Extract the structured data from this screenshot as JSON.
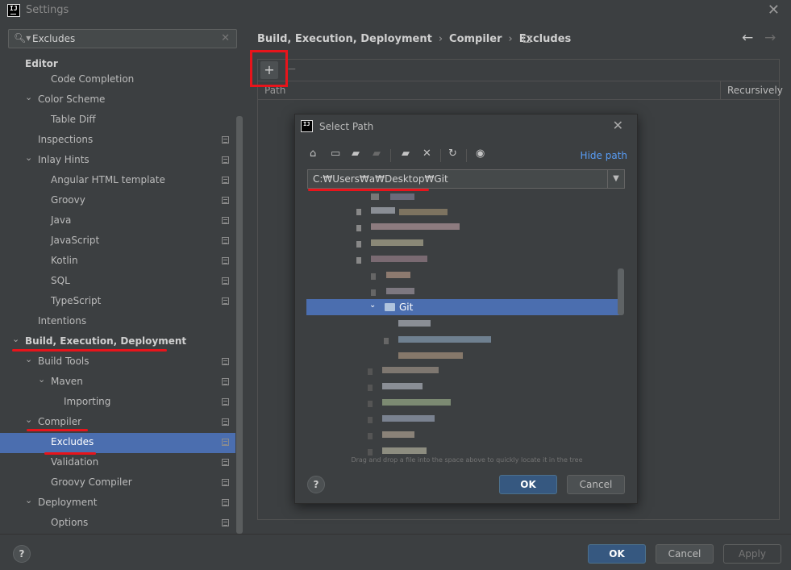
{
  "window": {
    "title": "Settings",
    "logo_text": "IJ"
  },
  "search": {
    "value": "Excludes"
  },
  "sidebar": {
    "items": [
      {
        "label": "Editor"
      },
      {
        "label": "Code Completion"
      },
      {
        "label": "Color Scheme"
      },
      {
        "label": "Table Diff"
      },
      {
        "label": "Inspections"
      },
      {
        "label": "Inlay Hints"
      },
      {
        "label": "Angular HTML template"
      },
      {
        "label": "Groovy"
      },
      {
        "label": "Java"
      },
      {
        "label": "JavaScript"
      },
      {
        "label": "Kotlin"
      },
      {
        "label": "SQL"
      },
      {
        "label": "TypeScript"
      },
      {
        "label": "Intentions"
      },
      {
        "label": "Build, Execution, Deployment"
      },
      {
        "label": "Build Tools"
      },
      {
        "label": "Maven"
      },
      {
        "label": "Importing"
      },
      {
        "label": "Compiler"
      },
      {
        "label": "Excludes"
      },
      {
        "label": "Validation"
      },
      {
        "label": "Groovy Compiler"
      },
      {
        "label": "Deployment"
      },
      {
        "label": "Options"
      }
    ]
  },
  "breadcrumb": [
    "Build, Execution, Deployment",
    "Compiler",
    "Excludes"
  ],
  "excludes_panel": {
    "add_label": "+",
    "remove_label": "−",
    "columns": [
      "Path",
      "Recursively"
    ]
  },
  "dialog": {
    "title": "Select Path",
    "hide_path": "Hide path",
    "path_value": "C:₩Users₩a₩Desktop₩Git",
    "selected_folder": "Git",
    "hint": "Drag and drop a file into the space above to quickly locate it in the tree",
    "ok": "OK",
    "cancel": "Cancel",
    "help": "?"
  },
  "footer": {
    "ok": "OK",
    "cancel": "Cancel",
    "apply": "Apply",
    "help": "?"
  },
  "colors": {
    "accent": "#4b6eaf",
    "annotation": "#e8141b",
    "link": "#589df6"
  }
}
